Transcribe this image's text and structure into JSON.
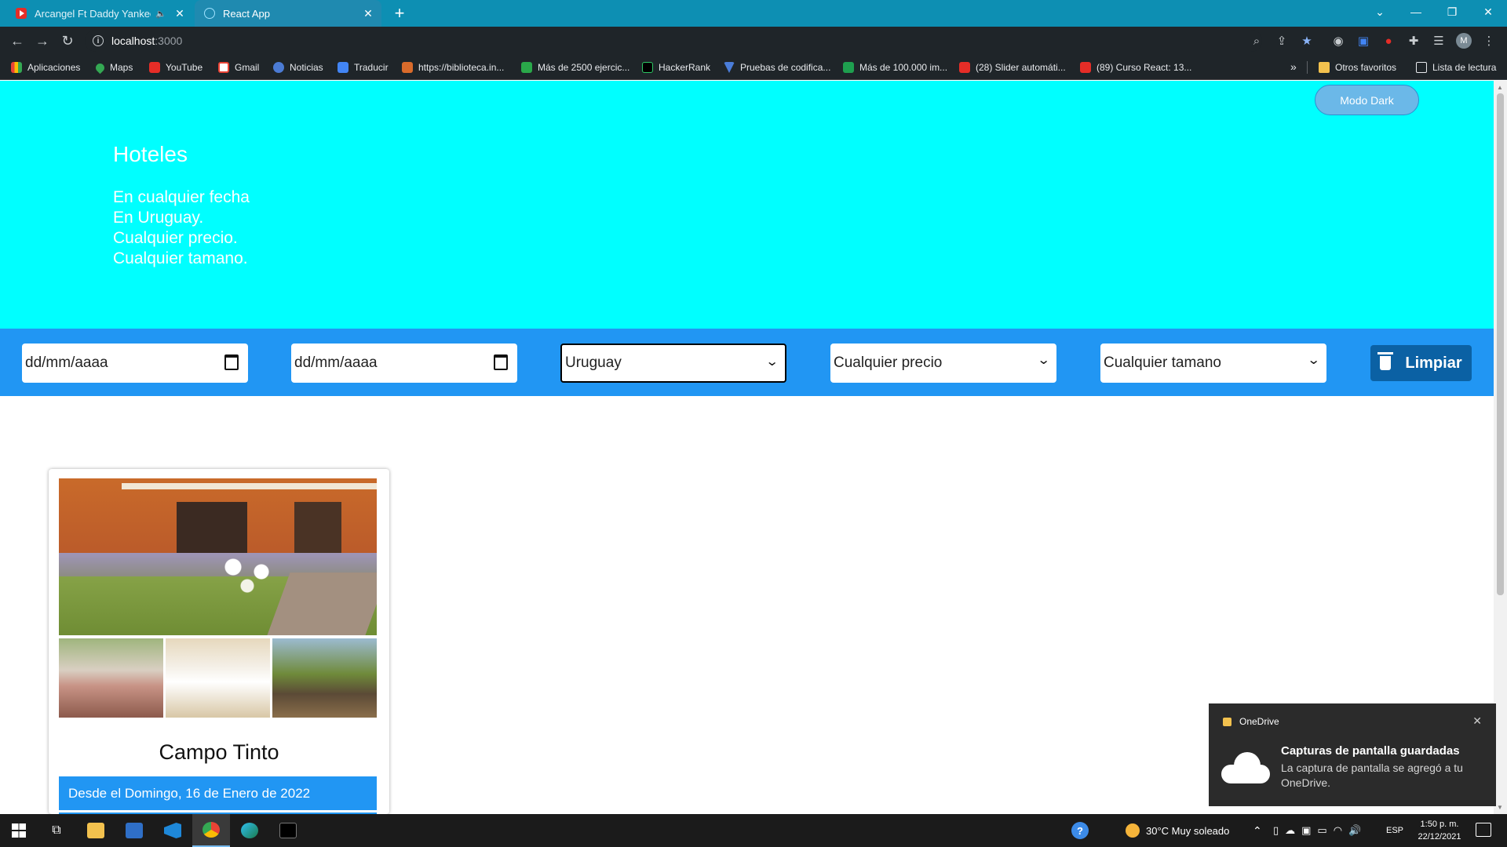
{
  "browser": {
    "tabs": [
      {
        "title": "Arcangel Ft Daddy Yankee Ft",
        "active": false
      },
      {
        "title": "React App",
        "active": true
      }
    ],
    "url_host": "localhost",
    "url_port": ":3000",
    "bookmarks": [
      "Aplicaciones",
      "Maps",
      "YouTube",
      "Gmail",
      "Noticias",
      "Traducir",
      "https://biblioteca.in...",
      "Más de 2500 ejercic...",
      "HackerRank",
      "Pruebas de codifica...",
      "Más de 100.000 im...",
      "(28) Slider automáti...",
      "(89) Curso React: 13..."
    ],
    "bookmarks_more": "»",
    "other_favorites": "Otros favoritos",
    "reading_list": "Lista de lectura",
    "avatar_letter": "M"
  },
  "hero": {
    "title": "Hoteles",
    "lines": [
      "En cualquier fecha",
      "En Uruguay.",
      "Cualquier precio.",
      "Cualquier tamano."
    ],
    "dark_mode_label": "Modo Dark",
    "bg_color": "#00ffff"
  },
  "filters": {
    "date_from_placeholder": "dd/mm/aaaa",
    "date_to_placeholder": "dd/mm/aaaa",
    "country_selected": "Uruguay",
    "price_selected": "Cualquier precio",
    "size_selected": "Cualquier tamano",
    "clear_label": "Limpiar",
    "bar_color": "#2196f3",
    "clear_color": "#0b61a4"
  },
  "hotel_card": {
    "name": "Campo Tinto",
    "availability": "Desde el Domingo, 16 de Enero de 2022"
  },
  "toast": {
    "app": "OneDrive",
    "title": "Capturas de pantalla guardadas",
    "body": "La captura de pantalla se agregó a tu OneDrive."
  },
  "taskbar": {
    "weather": "30°C  Muy soleado",
    "language": "ESP",
    "time": "1:50 p. m.",
    "date": "22/12/2021"
  }
}
